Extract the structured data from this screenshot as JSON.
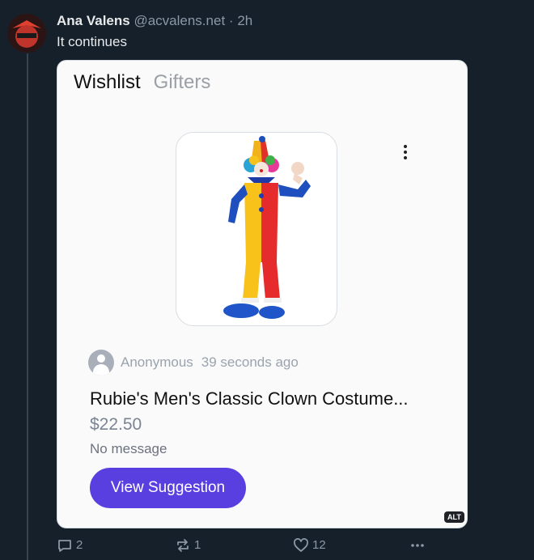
{
  "post": {
    "author_name": "Ana Valens",
    "handle": "@acvalens.net",
    "separator": "·",
    "time": "2h",
    "text": "It continues"
  },
  "card": {
    "tabs": [
      {
        "label": "Wishlist",
        "active": true
      },
      {
        "label": "Gifters",
        "active": false
      }
    ],
    "suggester": "Anonymous",
    "time_ago": "39 seconds ago",
    "product_title": "Rubie's Men's Classic Clown Costume...",
    "price": "$22.50",
    "message": "No message",
    "button_label": "View Suggestion",
    "alt_badge": "ALT",
    "colors": {
      "button": "#5a3fe0",
      "card_bg": "#fafafa"
    }
  },
  "actions": {
    "replies": "2",
    "reposts": "1",
    "likes": "12"
  },
  "icons": [
    "avatar",
    "more-vert-icon",
    "user-icon",
    "reply-icon",
    "repost-icon",
    "like-icon",
    "more-horiz-icon"
  ]
}
